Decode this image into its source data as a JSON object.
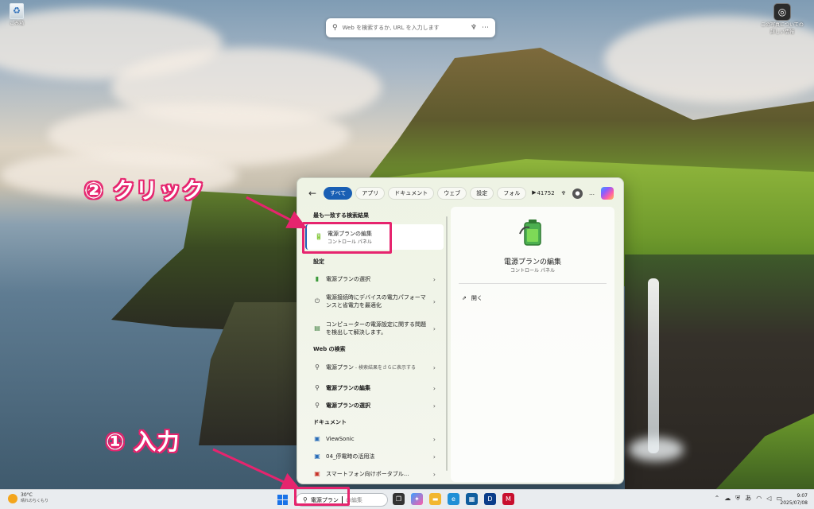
{
  "desktop": {
    "recycle_bin_label": "ごみ箱",
    "learn_label": "この写真についての詳しい情報"
  },
  "edge_bar": {
    "placeholder": "Web を検索するか, URL を入力します"
  },
  "annotations": {
    "click": "② クリック",
    "input": "① 入力"
  },
  "flyout": {
    "tabs": [
      "すべて",
      "アプリ",
      "ドキュメント",
      "ウェブ",
      "設定",
      "フォル"
    ],
    "tabs_more": "▶",
    "points": "41752",
    "more": "…",
    "best_match": {
      "heading": "最も一致する検索結果",
      "title": "電源プランの編集",
      "sub": "コントロール パネル"
    },
    "settings": {
      "heading": "設定",
      "items": [
        "電源プランの選択",
        "電源接続時にデバイスの電力パフォーマンスと省電力を最適化",
        "コンピューターの電源設定に関する問題を検出して解決します。"
      ]
    },
    "web": {
      "heading": "Web の検索",
      "items": [
        {
          "text": "電源プラン",
          "sub": " - 検索結果をさらに表示する"
        },
        {
          "text": "電源プランの編集",
          "sub": ""
        },
        {
          "text": "電源プランの選択",
          "sub": ""
        }
      ]
    },
    "documents": {
      "heading": "ドキュメント",
      "items": [
        "ViewSonic",
        "04_停電時の活用法",
        "スマートフォン向けポータブル..."
      ]
    },
    "detail": {
      "title": "電源プランの編集",
      "sub": "コントロール パネル",
      "open": "開く"
    }
  },
  "taskbar": {
    "weather_temp": "30°C",
    "weather_desc": "晴れのちくもり",
    "search_query": "電源プラン",
    "search_rest": "の編集",
    "ime": "あ",
    "time": "9:07",
    "date": "2025/07/08"
  }
}
